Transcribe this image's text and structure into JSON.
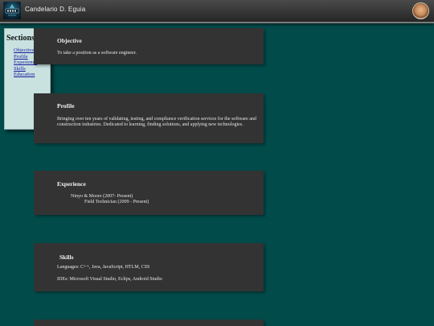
{
  "header": {
    "owner_name": "Candelario D. Eguia",
    "logo_icon": "logo-emblem-icon",
    "avatar_icon": "profile-avatar"
  },
  "sidebar": {
    "title": "Sections",
    "items": [
      {
        "label": "Objective"
      },
      {
        "label": "Profile"
      },
      {
        "label": "Experience"
      },
      {
        "label": "Skills"
      },
      {
        "label": "Education"
      }
    ]
  },
  "objective": {
    "title": "Objective",
    "text": "To take a position as a software engineer."
  },
  "profile": {
    "title": "Profile",
    "text": "Bringing over ten years of validating, testing, and compliance verification services for the software and construction industries. Dedicated to learning, finding solutions, and applying new technologies."
  },
  "experience": {
    "title": "Experience",
    "company": "Ninyo & Moore (2007- Present)",
    "role": "Field Technician (2009 - Present)"
  },
  "skills": {
    "title": "Skills",
    "languages": "Languages: C++, Java, JavaScript, HTLM, CSS",
    "ides": "IDEs: Microsoft Visual Studio, Eclips, Android Studio"
  },
  "colors": {
    "page_background": "#014b4b",
    "panel_background": "#333333",
    "sidebar_background": "#c9e2e0",
    "link": "#1a1aa0"
  }
}
